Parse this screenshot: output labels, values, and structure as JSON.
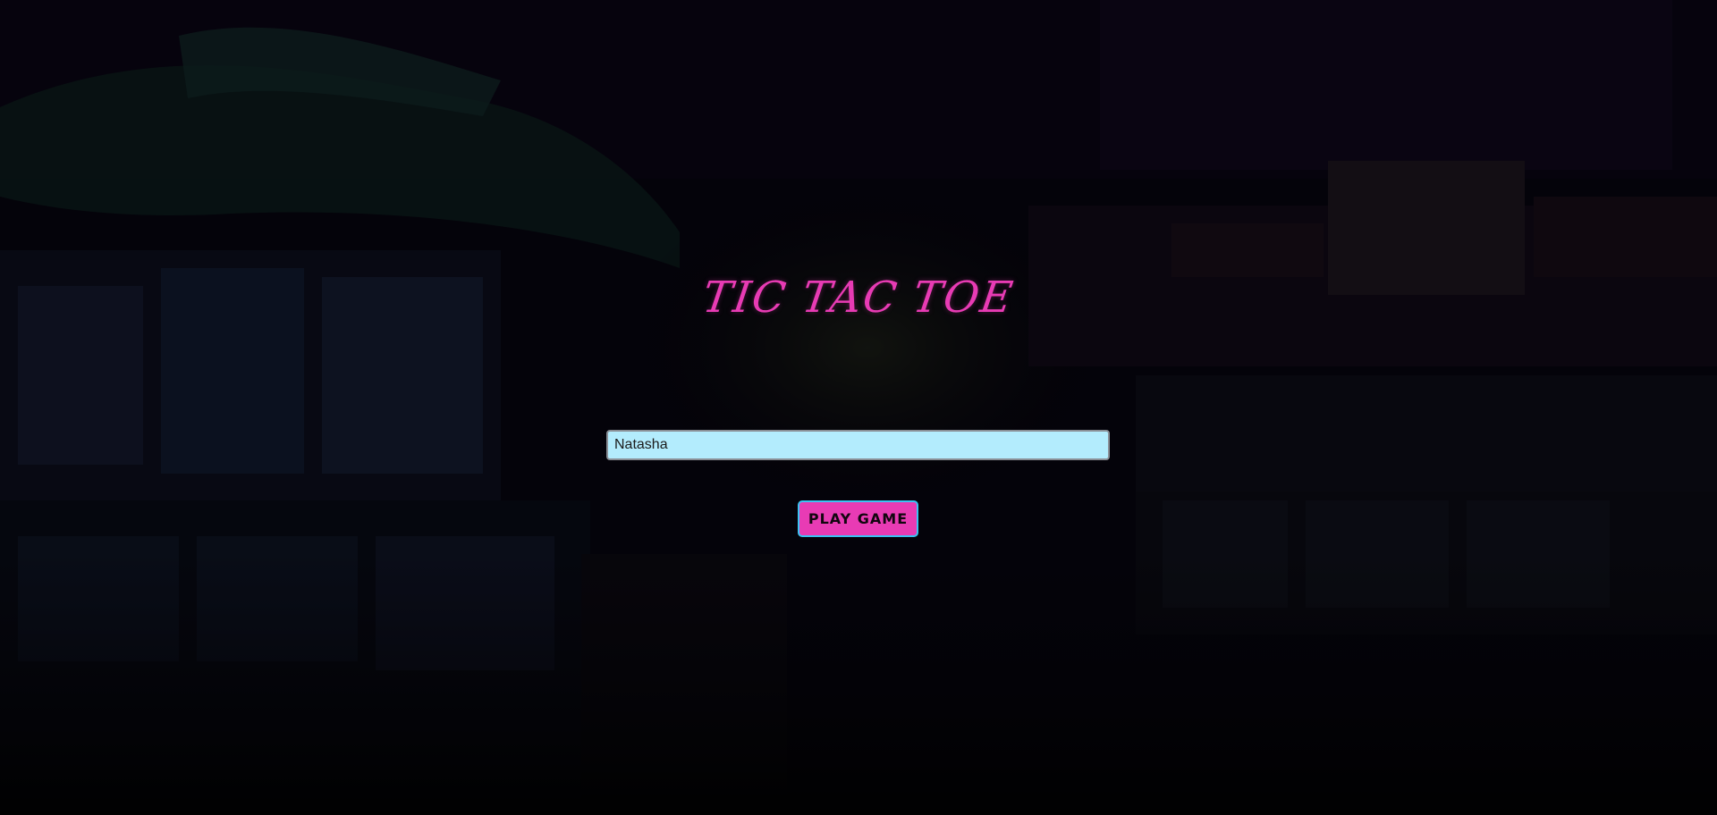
{
  "app": {
    "title": "TIC TAC TOE"
  },
  "form": {
    "name_value": "Natasha",
    "play_label": "PLAY GAME"
  },
  "colors": {
    "accent_pink": "#e83bb4",
    "input_bg": "#b3ecfd",
    "button_border": "#39c3f2",
    "background": "#050308"
  }
}
